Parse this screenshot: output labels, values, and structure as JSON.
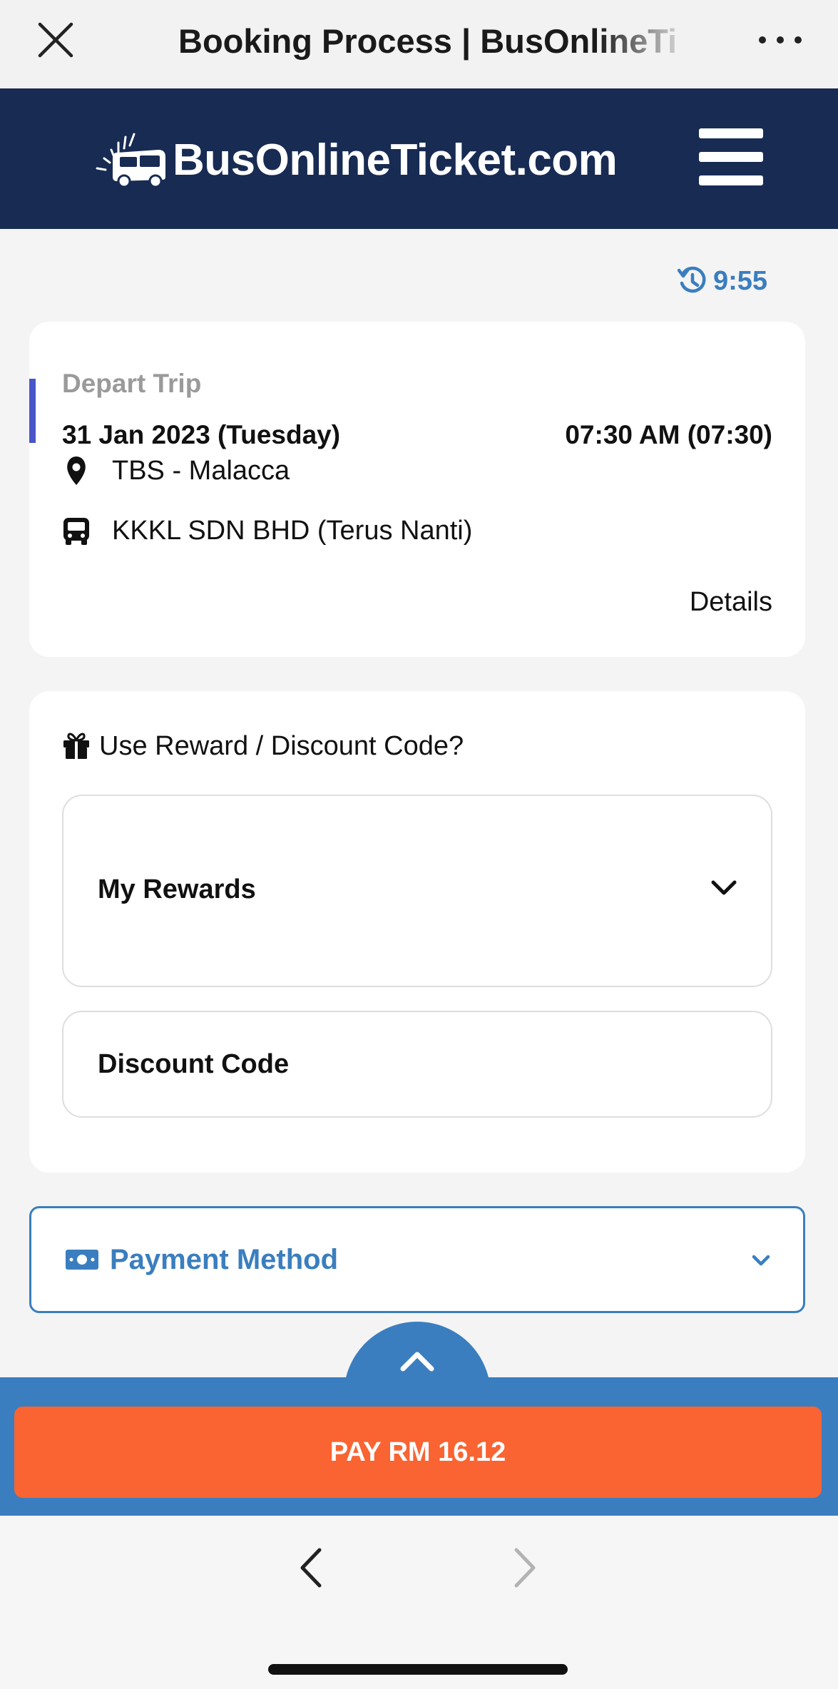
{
  "browser": {
    "title": "Booking Process | BusOnlineTicket.com",
    "close_icon": "close-icon",
    "more_icon": "more-dots-icon"
  },
  "site": {
    "logo_text": "BusOnlineTicket.com",
    "logo_icon": "bus-logo-icon",
    "menu_icon": "hamburger-icon",
    "header_color": "#172b53"
  },
  "timer": {
    "value": "9:55",
    "icon": "history-clock-icon"
  },
  "trip": {
    "label": "Depart Trip",
    "date": "31 Jan 2023 (Tuesday)",
    "time": "07:30 AM (07:30)",
    "route": "TBS - Malacca",
    "route_icon": "map-pin-icon",
    "operator": "KKKL SDN BHD (Terus Nanti)",
    "operator_icon": "bus-icon",
    "details_link": "Details"
  },
  "reward": {
    "heading": "Use Reward / Discount Code?",
    "heading_icon": "gift-icon",
    "my_rewards_label": "My Rewards",
    "discount_code_label": "Discount Code"
  },
  "payment": {
    "label": "Payment Method",
    "icon": "money-bill-icon"
  },
  "pay": {
    "button_label": "PAY RM 16.12",
    "button_color": "#f96432",
    "bar_color": "#3a7ebf"
  },
  "colors": {
    "accent_blue": "#3a7ebf",
    "trip_accent": "#4a55c7"
  }
}
